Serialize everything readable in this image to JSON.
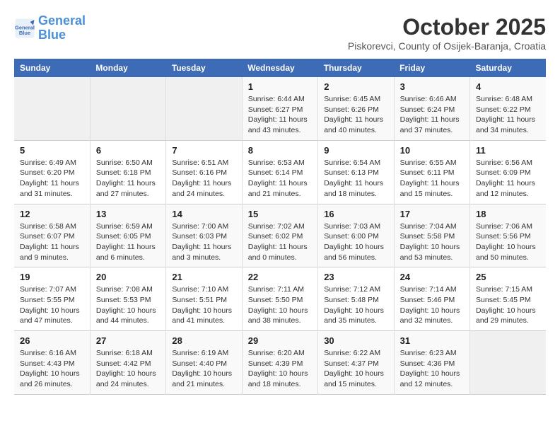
{
  "header": {
    "logo_line1": "General",
    "logo_line2": "Blue",
    "month": "October 2025",
    "location": "Piskorevci, County of Osijek-Baranja, Croatia"
  },
  "weekdays": [
    "Sunday",
    "Monday",
    "Tuesday",
    "Wednesday",
    "Thursday",
    "Friday",
    "Saturday"
  ],
  "weeks": [
    [
      {
        "day": "",
        "info": ""
      },
      {
        "day": "",
        "info": ""
      },
      {
        "day": "",
        "info": ""
      },
      {
        "day": "1",
        "info": "Sunrise: 6:44 AM\nSunset: 6:27 PM\nDaylight: 11 hours\nand 43 minutes."
      },
      {
        "day": "2",
        "info": "Sunrise: 6:45 AM\nSunset: 6:26 PM\nDaylight: 11 hours\nand 40 minutes."
      },
      {
        "day": "3",
        "info": "Sunrise: 6:46 AM\nSunset: 6:24 PM\nDaylight: 11 hours\nand 37 minutes."
      },
      {
        "day": "4",
        "info": "Sunrise: 6:48 AM\nSunset: 6:22 PM\nDaylight: 11 hours\nand 34 minutes."
      }
    ],
    [
      {
        "day": "5",
        "info": "Sunrise: 6:49 AM\nSunset: 6:20 PM\nDaylight: 11 hours\nand 31 minutes."
      },
      {
        "day": "6",
        "info": "Sunrise: 6:50 AM\nSunset: 6:18 PM\nDaylight: 11 hours\nand 27 minutes."
      },
      {
        "day": "7",
        "info": "Sunrise: 6:51 AM\nSunset: 6:16 PM\nDaylight: 11 hours\nand 24 minutes."
      },
      {
        "day": "8",
        "info": "Sunrise: 6:53 AM\nSunset: 6:14 PM\nDaylight: 11 hours\nand 21 minutes."
      },
      {
        "day": "9",
        "info": "Sunrise: 6:54 AM\nSunset: 6:13 PM\nDaylight: 11 hours\nand 18 minutes."
      },
      {
        "day": "10",
        "info": "Sunrise: 6:55 AM\nSunset: 6:11 PM\nDaylight: 11 hours\nand 15 minutes."
      },
      {
        "day": "11",
        "info": "Sunrise: 6:56 AM\nSunset: 6:09 PM\nDaylight: 11 hours\nand 12 minutes."
      }
    ],
    [
      {
        "day": "12",
        "info": "Sunrise: 6:58 AM\nSunset: 6:07 PM\nDaylight: 11 hours\nand 9 minutes."
      },
      {
        "day": "13",
        "info": "Sunrise: 6:59 AM\nSunset: 6:05 PM\nDaylight: 11 hours\nand 6 minutes."
      },
      {
        "day": "14",
        "info": "Sunrise: 7:00 AM\nSunset: 6:03 PM\nDaylight: 11 hours\nand 3 minutes."
      },
      {
        "day": "15",
        "info": "Sunrise: 7:02 AM\nSunset: 6:02 PM\nDaylight: 11 hours\nand 0 minutes."
      },
      {
        "day": "16",
        "info": "Sunrise: 7:03 AM\nSunset: 6:00 PM\nDaylight: 10 hours\nand 56 minutes."
      },
      {
        "day": "17",
        "info": "Sunrise: 7:04 AM\nSunset: 5:58 PM\nDaylight: 10 hours\nand 53 minutes."
      },
      {
        "day": "18",
        "info": "Sunrise: 7:06 AM\nSunset: 5:56 PM\nDaylight: 10 hours\nand 50 minutes."
      }
    ],
    [
      {
        "day": "19",
        "info": "Sunrise: 7:07 AM\nSunset: 5:55 PM\nDaylight: 10 hours\nand 47 minutes."
      },
      {
        "day": "20",
        "info": "Sunrise: 7:08 AM\nSunset: 5:53 PM\nDaylight: 10 hours\nand 44 minutes."
      },
      {
        "day": "21",
        "info": "Sunrise: 7:10 AM\nSunset: 5:51 PM\nDaylight: 10 hours\nand 41 minutes."
      },
      {
        "day": "22",
        "info": "Sunrise: 7:11 AM\nSunset: 5:50 PM\nDaylight: 10 hours\nand 38 minutes."
      },
      {
        "day": "23",
        "info": "Sunrise: 7:12 AM\nSunset: 5:48 PM\nDaylight: 10 hours\nand 35 minutes."
      },
      {
        "day": "24",
        "info": "Sunrise: 7:14 AM\nSunset: 5:46 PM\nDaylight: 10 hours\nand 32 minutes."
      },
      {
        "day": "25",
        "info": "Sunrise: 7:15 AM\nSunset: 5:45 PM\nDaylight: 10 hours\nand 29 minutes."
      }
    ],
    [
      {
        "day": "26",
        "info": "Sunrise: 6:16 AM\nSunset: 4:43 PM\nDaylight: 10 hours\nand 26 minutes."
      },
      {
        "day": "27",
        "info": "Sunrise: 6:18 AM\nSunset: 4:42 PM\nDaylight: 10 hours\nand 24 minutes."
      },
      {
        "day": "28",
        "info": "Sunrise: 6:19 AM\nSunset: 4:40 PM\nDaylight: 10 hours\nand 21 minutes."
      },
      {
        "day": "29",
        "info": "Sunrise: 6:20 AM\nSunset: 4:39 PM\nDaylight: 10 hours\nand 18 minutes."
      },
      {
        "day": "30",
        "info": "Sunrise: 6:22 AM\nSunset: 4:37 PM\nDaylight: 10 hours\nand 15 minutes."
      },
      {
        "day": "31",
        "info": "Sunrise: 6:23 AM\nSunset: 4:36 PM\nDaylight: 10 hours\nand 12 minutes."
      },
      {
        "day": "",
        "info": ""
      }
    ]
  ]
}
